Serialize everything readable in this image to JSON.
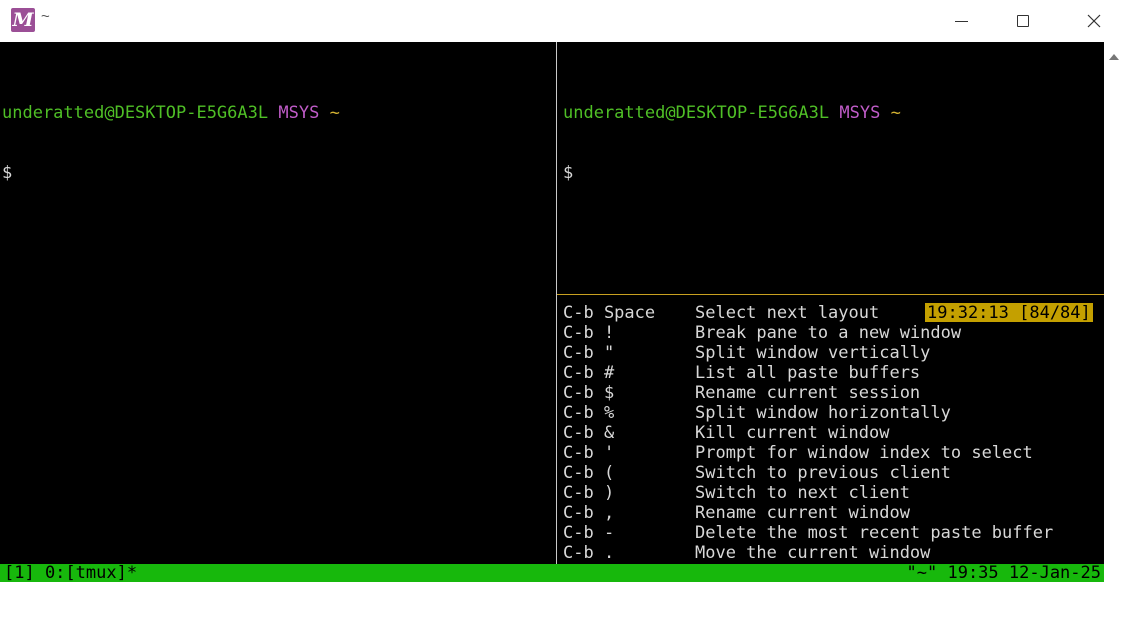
{
  "window": {
    "title": "~",
    "app_logo": "M",
    "controls": {
      "minimize": "minimize-icon",
      "maximize": "maximize-icon",
      "close": "close-icon"
    }
  },
  "panes": {
    "left": {
      "user_host": "underatted@DESKTOP-E5G6A3L",
      "system": "MSYS",
      "cwd": "~",
      "prompt": "$"
    },
    "right_top": {
      "user_host": "underatted@DESKTOP-E5G6A3L",
      "system": "MSYS",
      "cwd": "~",
      "prompt": "$"
    },
    "keys": {
      "position_badge": "19:32:13 [84/84]",
      "rows": [
        {
          "key": "C-b Space",
          "desc": "Select next layout"
        },
        {
          "key": "C-b !",
          "desc": "Break pane to a new window"
        },
        {
          "key": "C-b \"",
          "desc": "Split window vertically"
        },
        {
          "key": "C-b #",
          "desc": "List all paste buffers"
        },
        {
          "key": "C-b $",
          "desc": "Rename current session"
        },
        {
          "key": "C-b %",
          "desc": "Split window horizontally"
        },
        {
          "key": "C-b &",
          "desc": "Kill current window"
        },
        {
          "key": "C-b '",
          "desc": "Prompt for window index to select"
        },
        {
          "key": "C-b (",
          "desc": "Switch to previous client"
        },
        {
          "key": "C-b )",
          "desc": "Switch to next client"
        },
        {
          "key": "C-b ,",
          "desc": "Rename current window"
        },
        {
          "key": "C-b -",
          "desc": "Delete the most recent paste buffer"
        },
        {
          "key": "C-b .",
          "desc": "Move the current window"
        }
      ]
    }
  },
  "statusbar": {
    "left": "[1] 0:[tmux]*",
    "right": "\"~\" 19:35 12-Jan-25"
  },
  "colors": {
    "terminal_bg": "#000000",
    "user_host": "#4fbf26",
    "system": "#c05cc8",
    "cwd": "#d4b232",
    "status_bar": "#17b80c",
    "position_badge": "#c4a000",
    "active_border": "#c8a020"
  }
}
